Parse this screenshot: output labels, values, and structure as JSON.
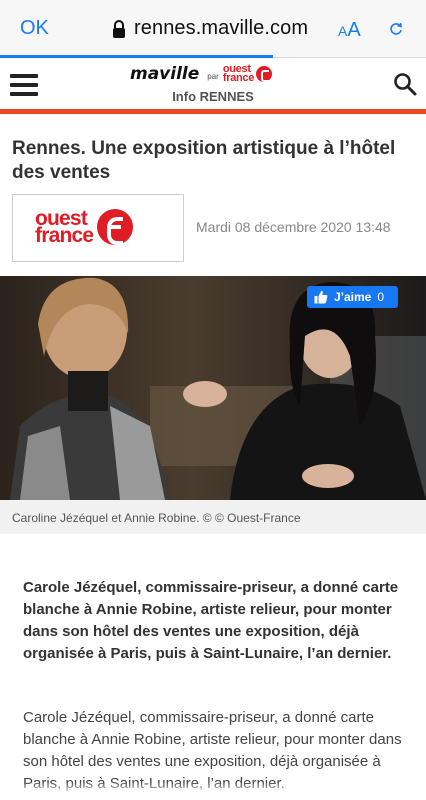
{
  "browser": {
    "done_label": "OK",
    "url": "rennes.maville.com",
    "text_size_label_small": "A",
    "text_size_label_large": "A",
    "accent_color": "#1a7cf2",
    "load_progress": 0.64
  },
  "site": {
    "brand": "maville",
    "brand_par": "par",
    "partner_line1": "ouest",
    "partner_line2": "france",
    "subtitle": "Info RENNES",
    "accent_color": "#e8481c"
  },
  "article": {
    "title": "Rennes. Une exposition artistique à l’hôtel des ventes",
    "source_logo_line1": "ouest",
    "source_logo_line2": "france",
    "date": "Mardi 08 décembre 2020 13:48",
    "like_label": "J’aime",
    "like_count": "0",
    "caption": "Caroline Jézéquel et Annie Robine. © © Ouest-France",
    "lead": "Carole Jézéquel, commissaire-priseur, a donné carte blanche à Annie Robine, artiste relieur, pour monter dans son hôtel des ventes une exposition, déjà organisée à Paris, puis à Saint-Lunaire, l’an dernier.",
    "body": "Carole Jézéquel, commissaire-priseur, a donné carte blanche à Annie Robine, artiste relieur, pour monter dans son hôtel des ventes une exposition, déjà organisée à Paris, puis à Saint-Lunaire, l’an dernier."
  }
}
